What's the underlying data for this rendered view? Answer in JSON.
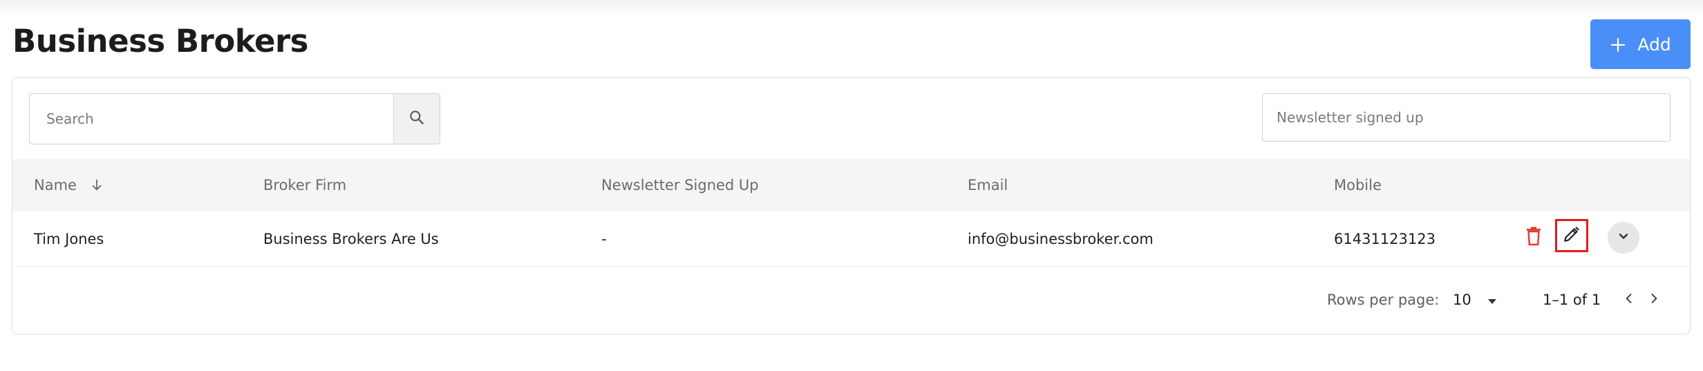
{
  "header": {
    "title": "Business Brokers",
    "add_label": "Add"
  },
  "toolbar": {
    "search_placeholder": "Search",
    "newsletter_filter_placeholder": "Newsletter signed up"
  },
  "table": {
    "columns": [
      "Name",
      "Broker Firm",
      "Newsletter Signed Up",
      "Email",
      "Mobile"
    ],
    "sort": {
      "column": "Name",
      "direction": "descending",
      "icon": "arrow-down-icon"
    },
    "rows": [
      {
        "name": "Tim Jones",
        "broker_firm": "Business Brokers Are Us",
        "newsletter": "-",
        "email": "info@businessbroker.com",
        "mobile": "61431123123"
      }
    ]
  },
  "pagination": {
    "rows_per_page_label": "Rows per page:",
    "rows_per_page": "10",
    "range": "1–1 of 1"
  },
  "colors": {
    "accent": "#4a8ff7",
    "delete": "#e53935",
    "highlight": "#e11b22"
  }
}
